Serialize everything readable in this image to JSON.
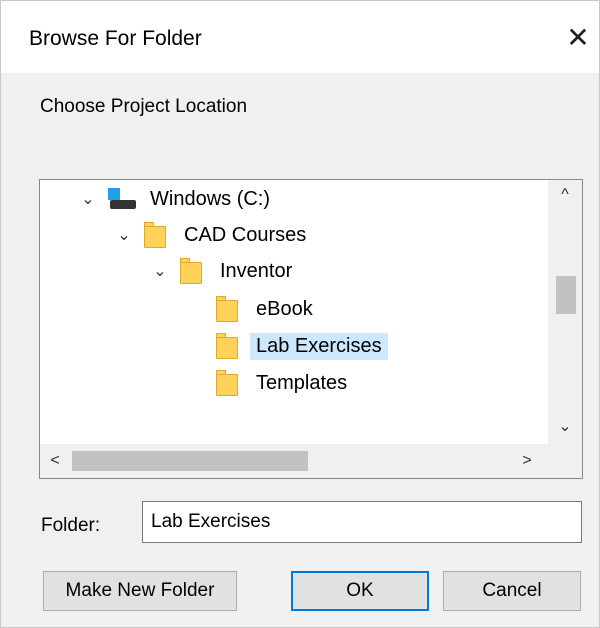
{
  "window": {
    "title": "Browse For Folder",
    "close_glyph": "✕"
  },
  "prompt": "Choose Project Location",
  "tree": {
    "nodes": [
      {
        "label": "Windows (C:)",
        "icon": "drive-icon",
        "expanded": true,
        "level": 0
      },
      {
        "label": "CAD Courses",
        "icon": "folder-icon",
        "expanded": true,
        "level": 1
      },
      {
        "label": "Inventor",
        "icon": "folder-icon",
        "expanded": true,
        "level": 2
      },
      {
        "label": "eBook",
        "icon": "folder-icon",
        "expanded": false,
        "level": 3
      },
      {
        "label": "Lab Exercises",
        "icon": "folder-icon",
        "expanded": false,
        "level": 3,
        "selected": true
      },
      {
        "label": "Templates",
        "icon": "folder-icon",
        "expanded": false,
        "level": 3
      }
    ],
    "scroll_up": "^",
    "scroll_down": "⌄",
    "scroll_left": "<",
    "scroll_right": ">",
    "expanded_glyph": "⌄"
  },
  "folder_field": {
    "label": "Folder:",
    "value": "Lab Exercises"
  },
  "buttons": {
    "make_new_folder": "Make New Folder",
    "ok": "OK",
    "cancel": "Cancel"
  },
  "colors": {
    "selection": "#cce8ff",
    "folder": "#ffd25b",
    "accent": "#0078d7"
  }
}
